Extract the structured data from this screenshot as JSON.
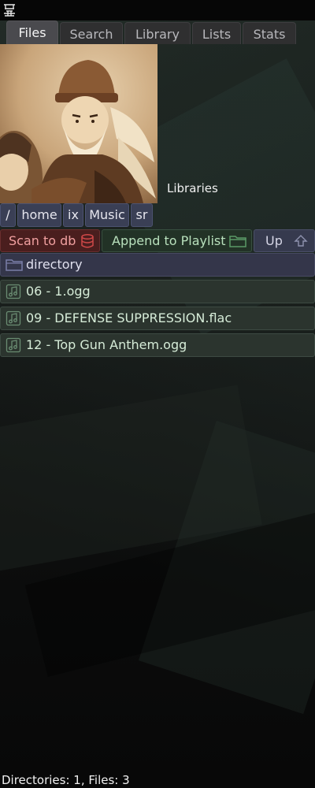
{
  "tabs": [
    {
      "label": "Files",
      "active": true
    },
    {
      "label": "Search",
      "active": false
    },
    {
      "label": "Library",
      "active": false
    },
    {
      "label": "Lists",
      "active": false
    },
    {
      "label": "Stats",
      "active": false
    }
  ],
  "album": {
    "libraries_label": "Libraries"
  },
  "breadcrumb": {
    "items": [
      "/",
      "home",
      "ix",
      "Music",
      "sr"
    ]
  },
  "actions": {
    "scan_label": "Scan to db",
    "scan_icon": "database-icon",
    "append_label": "Append to Playlist",
    "append_icon": "folder-icon",
    "up_label": "Up",
    "up_icon": "arrow-up-icon"
  },
  "entries": {
    "directories": [
      {
        "name": "directory",
        "icon": "folder-icon"
      }
    ],
    "files": [
      {
        "name": "06 - 1.ogg",
        "icon": "music-note-icon"
      },
      {
        "name": "09 - DEFENSE SUPPRESSION.flac",
        "icon": "music-note-icon"
      },
      {
        "name": "12 - Top Gun Anthem.ogg",
        "icon": "music-note-icon"
      }
    ]
  },
  "status": {
    "summary": "Directories: 1, Files: 3"
  },
  "colors": {
    "scan_accent": "#d04848",
    "append_accent": "#5a9a66",
    "dir_accent": "#7a7ea8",
    "file_accent": "#6a8c72"
  }
}
